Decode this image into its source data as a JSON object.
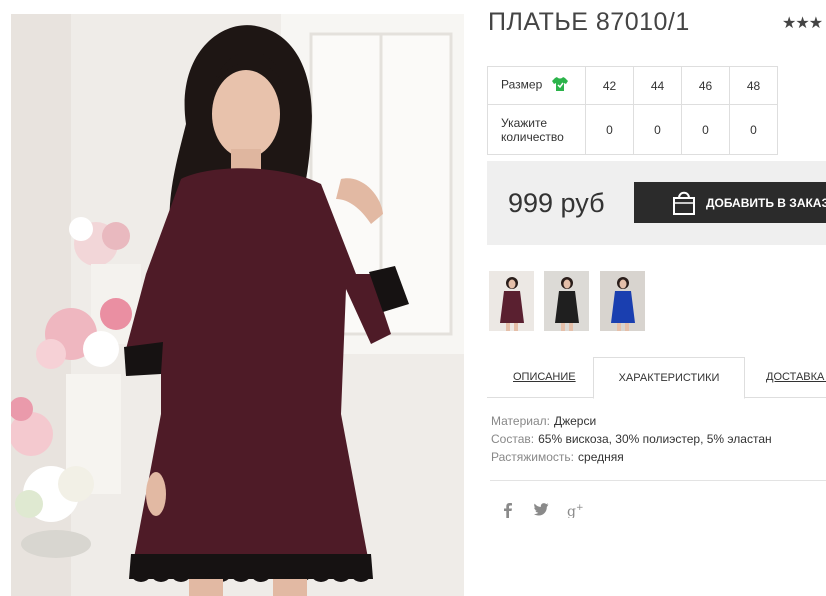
{
  "product": {
    "title": "ПЛАТЬЕ 87010/1",
    "rating_stars": "★★★"
  },
  "size_table": {
    "size_label": "Размер",
    "quantity_label_line1": "Укажите",
    "quantity_label_line2": "количество",
    "sizes": [
      "42",
      "44",
      "46",
      "48"
    ],
    "quantities": [
      "0",
      "0",
      "0",
      "0"
    ]
  },
  "price": {
    "value": "999 руб",
    "add_button_label": "ДОБАВИТЬ В ЗАКАЗ"
  },
  "thumbnails": [
    {
      "name": "thumb-burgundy",
      "dress_color": "#5a2030"
    },
    {
      "name": "thumb-black",
      "dress_color": "#1f1f1f"
    },
    {
      "name": "thumb-blue",
      "dress_color": "#1a3fb0"
    }
  ],
  "tabs": [
    {
      "label": "ОПИСАНИЕ",
      "active": false
    },
    {
      "label": "ХАРАКТЕРИСТИКИ",
      "active": true
    },
    {
      "label": "ДОСТАВКА И",
      "active": false
    }
  ],
  "specs": [
    {
      "key": "Материал:",
      "value": "Джерси"
    },
    {
      "key": "Состав:",
      "value": "65% вискоза, 30% полиэстер, 5% эластан"
    },
    {
      "key": "Растяжимость:",
      "value": "средняя"
    }
  ],
  "social": {
    "facebook": "f",
    "twitter": "t",
    "googleplus": "g+"
  },
  "colors": {
    "dress": "#4e1b27",
    "button_bg": "#2b2b2b",
    "price_bg": "#efefef",
    "tshirt_icon": "#2bb34a"
  }
}
